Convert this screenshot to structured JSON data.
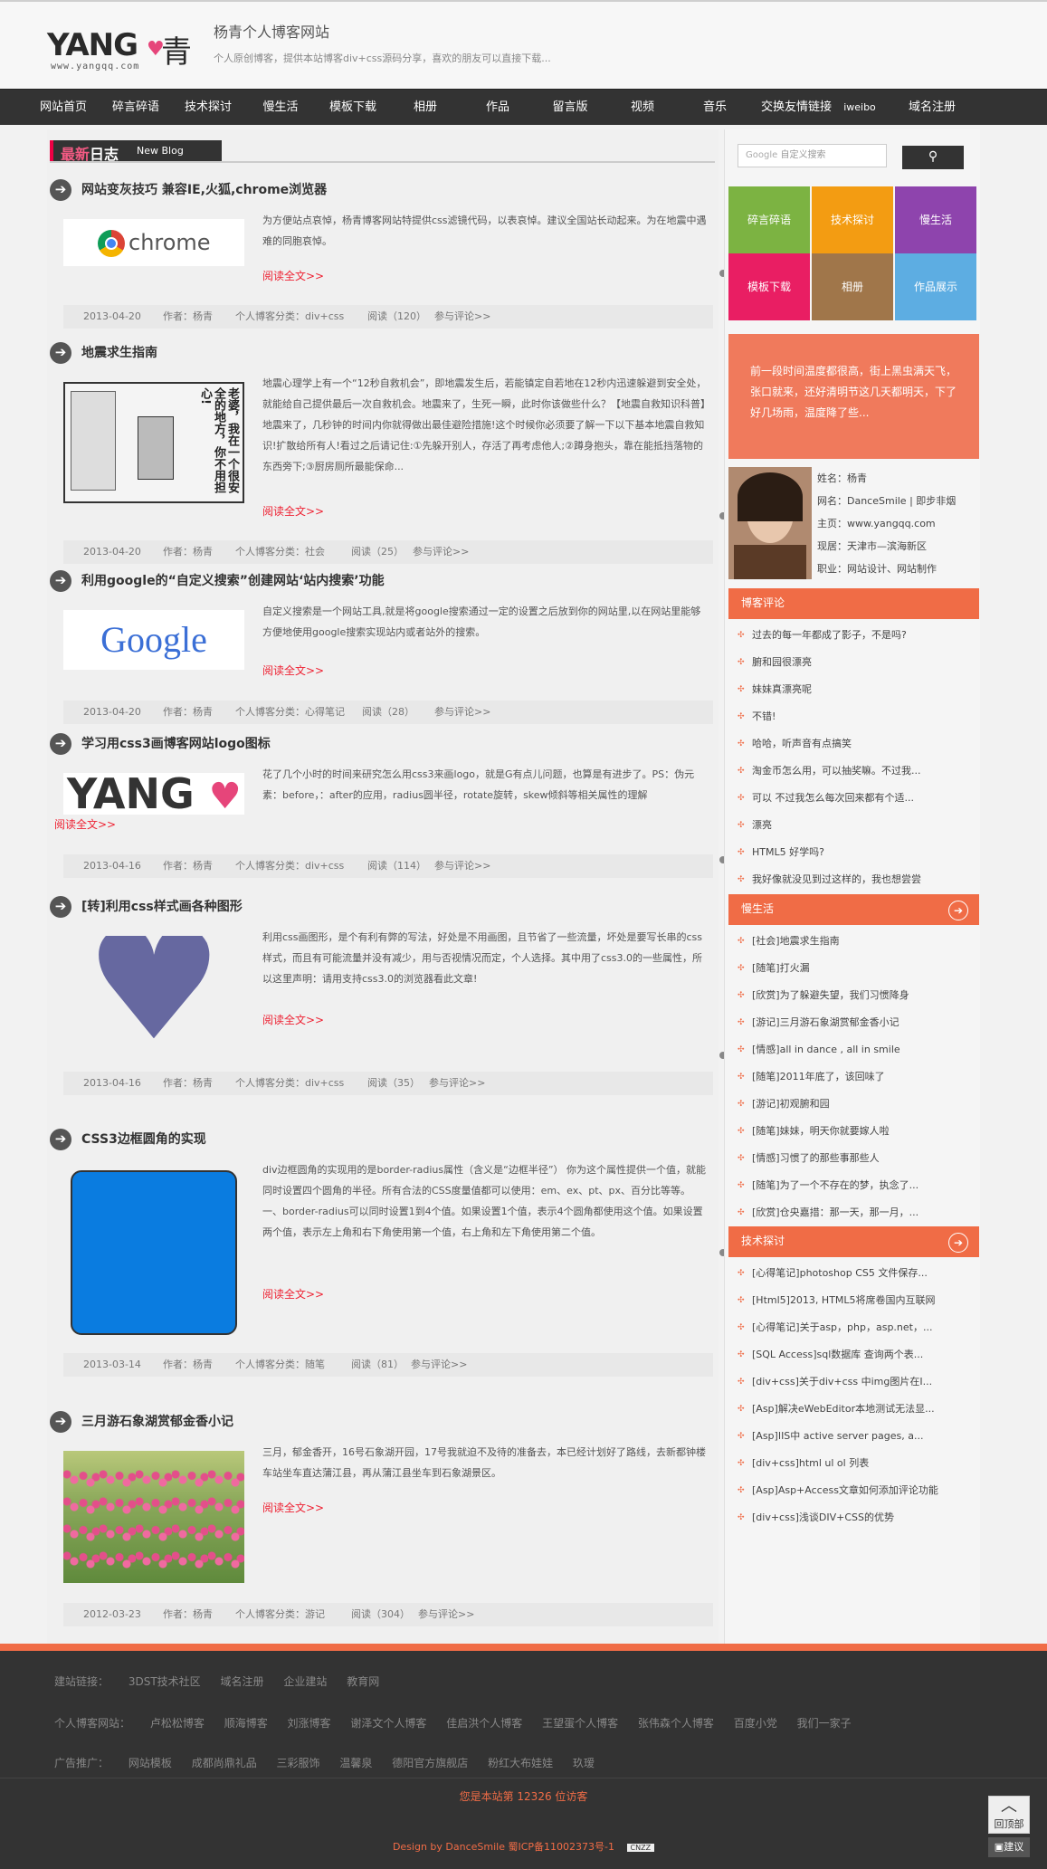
{
  "site": {
    "logo_text": "YANG",
    "logo_char": "青",
    "logo_url": "www.yangqq.com",
    "title": "杨青个人博客网站",
    "desc": "个人原创博客，提供本站博客div+css源码分享，喜欢的朋友可以直接下载..."
  },
  "nav": [
    "网站首页",
    "碎言碎语",
    "技术探讨",
    "慢生活",
    "模板下载",
    "相册",
    "作品",
    "留言版",
    "视频",
    "音乐",
    "交换友情链接",
    "iweibo",
    "域名注册"
  ],
  "newblog": {
    "prefix": "最新",
    "main": "日志",
    "en": "New Blog"
  },
  "read_more": "阅读全文>>",
  "posts": [
    {
      "title": "网站变灰技巧 兼容IE,火狐,chrome浏览器",
      "thumb_text": "chrome",
      "excerpt": "为方便站点哀悼，杨青博客网站特提供css滤镜代码，以表哀悼。建议全国站长动起来。为在地震中遇难的同胞哀悼。",
      "meta": {
        "date": "2013-04-20",
        "author": "作者：杨青",
        "cat": "个人博客分类：div+css",
        "views": "阅读（120）",
        "comment": "参与评论>>"
      }
    },
    {
      "title": "地震求生指南",
      "thumb_text": "老婆，我在一个很安全的地方，你不用担心!",
      "excerpt": "地震心理学上有一个“12秒自救机会”，即地震发生后，若能镇定自若地在12秒内迅速躲避到安全处，就能给自己提供最后一次自救机会。地震来了，生死一瞬，此时你该做些什么？【地震自救知识科普】地震来了，几秒钟的时间内你就得做出最佳避险措施!这个时候你必须要了解一下以下基本地震自救知识!扩散给所有人!看过之后请记住:①先躲开别人，存活了再考虑他人;②蹲身抱头，靠在能抵挡落物的东西旁下;③厨房厕所最能保命...",
      "meta": {
        "date": "2013-04-20",
        "author": "作者：杨青",
        "cat": "个人博客分类：社会",
        "views": "阅读（25）",
        "comment": "参与评论>>"
      }
    },
    {
      "title": "利用google的“自定义搜索”创建网站‘站内搜索’功能",
      "thumb_text": "Google",
      "excerpt": "自定义搜索是一个网站工具,就是将google搜索通过一定的设置之后放到你的网站里,以在网站里能够方便地使用google搜索实现站内或者站外的搜索。",
      "meta": {
        "date": "2013-04-20",
        "author": "作者：杨青",
        "cat": "个人博客分类：心得笔记",
        "views": "阅读（28）",
        "comment": "参与评论>>"
      }
    },
    {
      "title": "学习用css3画博客网站logo图标",
      "thumb_text": "YANG",
      "excerpt": "花了几个小时的时间来研究怎么用css3来画logo，就是G有点儿问题，也算是有进步了。PS：伪元素：before，：after的应用，radius圆半径，rotate旋转，skew倾斜等相关属性的理解",
      "meta": {
        "date": "2013-04-16",
        "author": "作者：杨青",
        "cat": "个人博客分类：div+css",
        "views": "阅读（114）",
        "comment": "参与评论>>"
      }
    },
    {
      "title": "[转]利用css样式画各种图形",
      "thumb_text": "",
      "excerpt": "利用css画图形，是个有利有弊的写法，好处是不用画图，且节省了一些流量，坏处是要写长串的css样式，而且有可能流量并没有减少，用与否视情况而定，个人选择。其中用了css3.0的一些属性，所以这里声明：请用支持css3.0的浏览器看此文章!",
      "meta": {
        "date": "2013-04-16",
        "author": "作者：杨青",
        "cat": "个人博客分类：div+css",
        "views": "阅读（35）",
        "comment": "参与评论>>"
      }
    },
    {
      "title": "CSS3边框圆角的实现",
      "thumb_text": "",
      "excerpt": "div边框圆角的实现用的是border-radius属性（含义是“边框半径”） 你为这个属性提供一个值，就能同时设置四个圆角的半径。所有合法的CSS度量值都可以使用：em、ex、pt、px、百分比等等。 一、border-radius可以同时设置1到4个值。如果设置1个值，表示4个圆角都使用这个值。如果设置两个值，表示左上角和右下角使用第一个值，右上角和左下角使用第二个值。",
      "meta": {
        "date": "2013-03-14",
        "author": "作者：杨青",
        "cat": "个人博客分类：随笔",
        "views": "阅读（81）",
        "comment": "参与评论>>"
      }
    },
    {
      "title": "三月游石象湖赏郁金香小记",
      "thumb_text": "",
      "excerpt": "三月，郁金香开，16号石象湖开园，17号我就迫不及待的准备去，本已经计划好了路线，去新都钟楼车站坐车直达蒲江县，再从蒲江县坐车到石象湖景区。",
      "meta": {
        "date": "2012-03-23",
        "author": "作者：杨青",
        "cat": "个人博客分类：游记",
        "views": "阅读（304）",
        "comment": "参与评论>>"
      }
    }
  ],
  "sidebar": {
    "search_placeholder": "自定义搜索",
    "search_logo": "Google",
    "tiles": [
      {
        "label": "碎言碎语",
        "color": "#7cb342"
      },
      {
        "label": "技术探讨",
        "color": "#f39c12"
      },
      {
        "label": "慢生活",
        "color": "#8e44ad"
      },
      {
        "label": "模板下载",
        "color": "#e91e63"
      },
      {
        "label": "相册",
        "color": "#a0764a"
      },
      {
        "label": "作品展示",
        "color": "#5dade2"
      }
    ],
    "notice": "前一段时间温度都很高，街上黑虫满天飞，张口就来，还好清明节这几天都明天，下了好几场雨，温度降了些...",
    "profile": [
      "姓名：杨青",
      "网名：DanceSmile | 即步非烟",
      "主页：www.yangqq.com",
      "现居：天津市—滨海新区",
      "职业：网站设计、网站制作"
    ],
    "comments_title": "博客评论",
    "comments": [
      "过去的每一年都成了影子，不是吗?",
      "腑和园很漂亮",
      "妹妹真漂亮呢",
      "不错!",
      "哈哈，听声音有点搞笑",
      "淘金币怎么用，可以抽奖嘛。不过我...",
      "可以  不过我怎么每次回来都有个适...",
      "漂亮",
      "HTML5 好学吗?",
      "我好像就没见到过这样的，我也想尝尝"
    ],
    "slowlife_title": "慢生活",
    "slowlife": [
      "[社会]地震求生指南",
      "[随笔]打火漏",
      "[欣赏]为了躲避失望，我们习惯降身",
      "[游记]三月游石象湖赏郁金香小记",
      "[情感]all in dance , all in smile",
      "[随笔]2011年底了，该回味了",
      "[游记]初观腑和园",
      "[随笔]妹妹，明天你就要嫁人啦",
      "[情感]习惯了的那些事那些人",
      "[随笔]为了一个不存在的梦，执念了...",
      "[欣赏]仓央嘉措：那一天，那一月，..."
    ],
    "tech_title": "技术探讨",
    "tech": [
      "[心得笔记]photoshop CS5 文件保存...",
      "[Html5]2013, HTML5将席卷国内互联网",
      "[心得笔记]关于asp，php，asp.net，...",
      "[SQL Access]sql数据库 查询两个表...",
      "[div+css]关于div+css 中img图片在I...",
      "[Asp]解决eWebEditor本地测试无法显...",
      "[Asp]IIS中 active server pages, a...",
      "[div+css]html ul ol 列表",
      "[Asp]Asp+Access文章如何添加评论功能",
      "[div+css]浅谈DIV+CSS的优势"
    ]
  },
  "footer": {
    "row1_label": "建站链接：",
    "row1": [
      "3DST技术社区",
      "域名注册",
      "企业建站",
      "教育网"
    ],
    "row2_label": "个人博客网站：",
    "row2": [
      "卢松松博客",
      "顺海博客",
      "刘涨博客",
      "谢泽文个人博客",
      "佳启洪个人博客",
      "王望蛋个人博客",
      "张伟森个人博客",
      "百度小党",
      "我们一家子"
    ],
    "row3_label": "广告推广：",
    "row3": [
      "网站模板",
      "成都尚鼎礼品",
      "三彩服饰",
      "温馨泉",
      "德阳官方旗舰店",
      "粉红大布娃娃",
      "玖瑷"
    ],
    "visit": "您是本站第 12326 位访客",
    "copyright": "Design by DanceSmile 蜀ICP备11002373号-1",
    "cnzz": "CNZZ"
  },
  "back_top": "回顶部",
  "suggest": "建议"
}
